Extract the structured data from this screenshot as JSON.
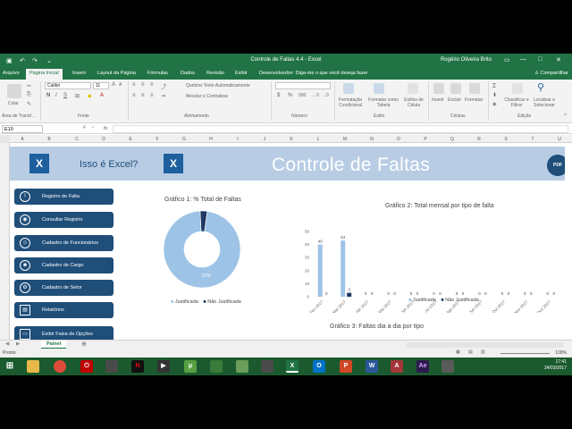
{
  "window": {
    "title": "Controle de Faltas 4.4 - Excel",
    "user": "Rogério Oliveira Brito"
  },
  "tabs": [
    "Arquivo",
    "Página Inicial",
    "Inserir",
    "Layout da Página",
    "Fórmulas",
    "Dados",
    "Revisão",
    "Exibir",
    "Desenvolvedor"
  ],
  "tell_me": "Diga-me o que você deseja fazer",
  "share": "Compartilhar",
  "ribbon": {
    "font_name": "Calibri",
    "font_size": "11",
    "wrap_text": "Quebrar Texto Automaticamente",
    "merge_center": "Mesclar e Centralizar",
    "paste": "Colar",
    "cond_format": "Formatação Condicional",
    "format_table": "Formatar como Tabela",
    "cell_styles": "Estilos de Célula",
    "insert": "Inserir",
    "delete": "Excluir",
    "format": "Formatar",
    "sort_filter": "Classificar e Filtrar",
    "find_select": "Localizar e Selecionar",
    "groups": {
      "clipboard": "Área de Transf...",
      "font": "Fonte",
      "alignment": "Alinhamento",
      "number": "Número",
      "style": "Estilo",
      "cells": "Células",
      "editing": "Edição"
    }
  },
  "formula_bar": {
    "name_box": "E10",
    "fx": "fx"
  },
  "columns": [
    "A",
    "B",
    "C",
    "D",
    "E",
    "F",
    "G",
    "H",
    "I",
    "J",
    "K",
    "L",
    "M",
    "N",
    "O",
    "P",
    "Q",
    "R",
    "S",
    "T",
    "U"
  ],
  "banner": {
    "subtitle": "Isso é Excel?",
    "title": "Controle de Faltas",
    "pdf": "PDF",
    "xl_letter": "X"
  },
  "nav": [
    {
      "label": "Registro de Falta",
      "icon": "!"
    },
    {
      "label": "Consultar Registro",
      "icon": "◉"
    },
    {
      "label": "Cadastro de Funcionários",
      "icon": "☺"
    },
    {
      "label": "Cadastro de Cargo",
      "icon": "☻"
    },
    {
      "label": "Cadastro de Setor",
      "icon": "⚙"
    },
    {
      "label": "Relatórios",
      "icon": "▤"
    },
    {
      "label": "Exibir Faixa de Opções",
      "icon": "▭"
    }
  ],
  "charts": {
    "c1_title": "Gráfico 1: % Total de Faltas",
    "c2_title": "Gráfico 2: Total mensal por tipo de falta",
    "c3_title": "Gráfico 3: Faltas dia a dia por tipo",
    "legend_j": "Justificada",
    "legend_n": "Não Justificada",
    "pie_small_label": "3%",
    "pie_big_label": "97%"
  },
  "chart_data": [
    {
      "type": "pie",
      "title": "Gráfico 1: % Total de Faltas",
      "categories": [
        "Justificada",
        "Não Justificada"
      ],
      "values": [
        97,
        3
      ],
      "colors": [
        "#9dc3e6",
        "#1f3864"
      ],
      "legend": "bottom"
    },
    {
      "type": "bar",
      "title": "Gráfico 2: Total mensal por tipo de falta",
      "categories": [
        "Fev 2017",
        "Mar 2017",
        "Abr 2017",
        "Mai 2017",
        "Jun 2017",
        "Jul 2017",
        "Ago 2017",
        "Set 2017",
        "Out 2017",
        "Nov 2017",
        "Dez 2017"
      ],
      "series": [
        {
          "name": "Justificada",
          "values": [
            40,
            43,
            0,
            0,
            0,
            0,
            0,
            0,
            0,
            0,
            0
          ],
          "color": "#9dc3e6"
        },
        {
          "name": "Não Justificada",
          "values": [
            0,
            3,
            0,
            0,
            0,
            0,
            0,
            0,
            0,
            0,
            0
          ],
          "color": "#1f3864"
        }
      ],
      "yticks": [
        "50",
        "40",
        "30",
        "20",
        "10",
        "0"
      ],
      "ylim": [
        0,
        50
      ],
      "legend": "bottom"
    }
  ],
  "sheet_tab": "Painel",
  "add_sheet": "⊕",
  "status": "Pronto",
  "zoom": "100%",
  "clock": {
    "time": "17:41",
    "date": "24/03/2017"
  }
}
